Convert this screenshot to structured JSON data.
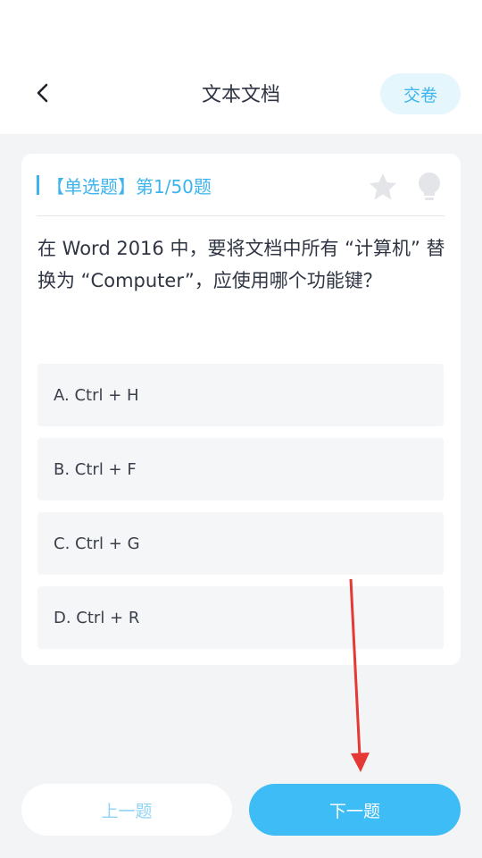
{
  "header": {
    "title": "文本文档",
    "submit_label": "交卷"
  },
  "question": {
    "type_label": "【单选题】第1/50题",
    "text": "在 Word 2016 中，要将文档中所有 “计算机” 替换为 “Computer”，应使用哪个功能键？",
    "options": [
      {
        "label": "A. Ctrl + H"
      },
      {
        "label": "B. Ctrl + F"
      },
      {
        "label": "C. Ctrl + G"
      },
      {
        "label": "D. Ctrl + R"
      }
    ]
  },
  "footer": {
    "prev_label": "上一题",
    "next_label": "下一题"
  },
  "icons": {
    "back": "chevron-left-icon",
    "favorite": "star-icon",
    "hint": "lightbulb-icon",
    "annotation": "red-arrow"
  },
  "colors": {
    "accent": "#3db4ee",
    "next_button": "#3dbcf5",
    "annotation_arrow": "#e53935"
  }
}
